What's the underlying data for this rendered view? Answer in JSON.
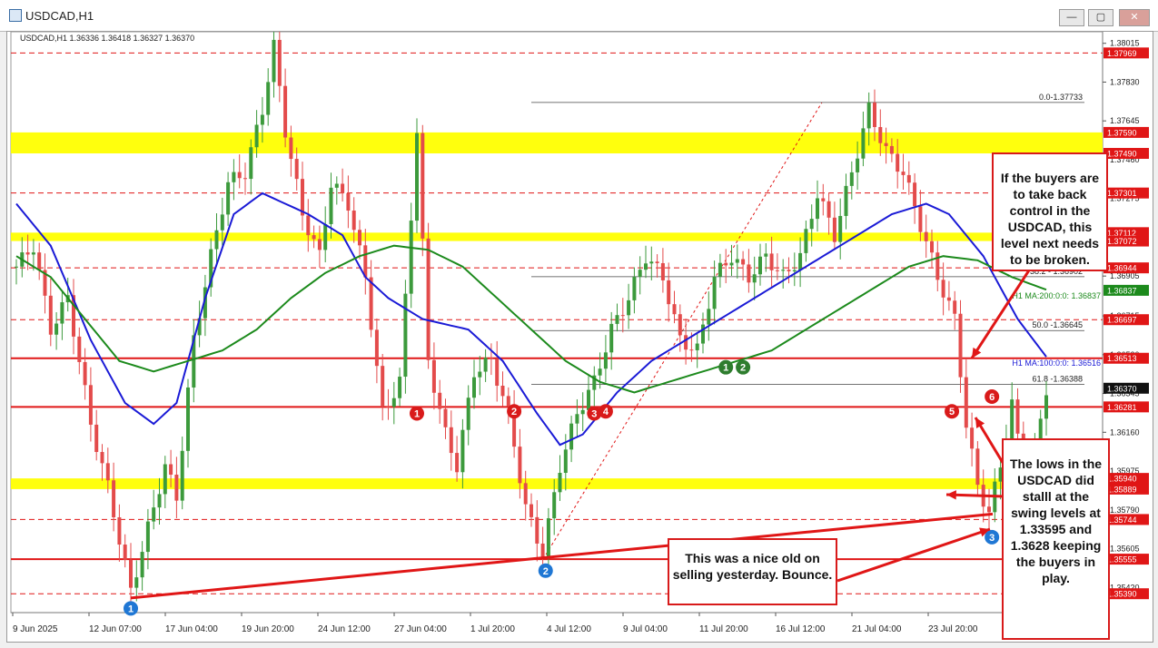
{
  "window": {
    "title": "USDCAD,H1",
    "min_label": "—",
    "max_label": "▢",
    "close_label": "✕"
  },
  "colors": {
    "blue": "#1a1ad6",
    "green": "#1c8a1c",
    "red": "#e01616",
    "yellow": "#ffff00",
    "bull": "#3c9a3c",
    "bear": "#e34b4b",
    "label_blue": "#1f77d4",
    "label_green": "#2e7d2e",
    "label_red": "#d91a1a"
  },
  "chart_data": {
    "type": "candlestick",
    "symbol": "USDCAD",
    "timeframe": "H1",
    "ohlc_header": "USDCAD,H1  1.36336 1.36418 1.36327 1.36370",
    "ylim": [
      1.353,
      1.3807
    ],
    "y_ticks": [
      "1.38015",
      "1.37830",
      "1.37645",
      "1.37460",
      "1.37275",
      "1.37090",
      "1.36905",
      "1.36715",
      "1.36530",
      "1.36345",
      "1.36160",
      "1.35975",
      "1.35790",
      "1.35605",
      "1.35420"
    ],
    "x_ticks": [
      "9 Jun 2025",
      "12 Jun 07:00",
      "17 Jun 04:00",
      "19 Jun 20:00",
      "24 Jun 12:00",
      "27 Jun 04:00",
      "1 Jul 20:00",
      "4 Jul 12:00",
      "9 Jul 04:00",
      "11 Jul 20:00",
      "16 Jul 12:00",
      "21 Jul 04:00",
      "23 Jul 20:00"
    ],
    "price_path": [
      [
        0,
        1.3695
      ],
      [
        3,
        1.3705
      ],
      [
        6,
        1.3665
      ],
      [
        9,
        1.368
      ],
      [
        13,
        1.362
      ],
      [
        16,
        1.359
      ],
      [
        20,
        1.354
      ],
      [
        23,
        1.357
      ],
      [
        26,
        1.36
      ],
      [
        28,
        1.3585
      ],
      [
        31,
        1.366
      ],
      [
        34,
        1.37
      ],
      [
        37,
        1.3735
      ],
      [
        40,
        1.374
      ],
      [
        43,
        1.377
      ],
      [
        45,
        1.38
      ],
      [
        47,
        1.376
      ],
      [
        50,
        1.372
      ],
      [
        53,
        1.37
      ],
      [
        55,
        1.3735
      ],
      [
        58,
        1.3725
      ],
      [
        61,
        1.369
      ],
      [
        64,
        1.3625
      ],
      [
        67,
        1.364
      ],
      [
        70,
        1.376
      ],
      [
        72,
        1.365
      ],
      [
        75,
        1.3615
      ],
      [
        77,
        1.36
      ],
      [
        80,
        1.3645
      ],
      [
        83,
        1.365
      ],
      [
        86,
        1.3625
      ],
      [
        89,
        1.358
      ],
      [
        92,
        1.3558
      ],
      [
        95,
        1.36
      ],
      [
        98,
        1.3625
      ],
      [
        101,
        1.364
      ],
      [
        104,
        1.3665
      ],
      [
        107,
        1.368
      ],
      [
        110,
        1.37
      ],
      [
        113,
        1.369
      ],
      [
        116,
        1.366
      ],
      [
        119,
        1.3655
      ],
      [
        122,
        1.369
      ],
      [
        125,
        1.37
      ],
      [
        128,
        1.369
      ],
      [
        131,
        1.37
      ],
      [
        134,
        1.369
      ],
      [
        137,
        1.37
      ],
      [
        140,
        1.373
      ],
      [
        143,
        1.371
      ],
      [
        146,
        1.374
      ],
      [
        149,
        1.377
      ],
      [
        152,
        1.375
      ],
      [
        155,
        1.374
      ],
      [
        158,
        1.3715
      ],
      [
        161,
        1.369
      ],
      [
        164,
        1.367
      ],
      [
        166,
        1.362
      ],
      [
        168,
        1.359
      ],
      [
        170,
        1.3578
      ],
      [
        172,
        1.36
      ],
      [
        174,
        1.363
      ],
      [
        176,
        1.3595
      ],
      [
        178,
        1.3605
      ],
      [
        180,
        1.3637
      ]
    ],
    "series": [
      {
        "name": "H1 MA:100:0:0: 1.36516",
        "values_path": [
          [
            0,
            1.3725
          ],
          [
            6,
            1.3705
          ],
          [
            13,
            1.366
          ],
          [
            19,
            1.363
          ],
          [
            24,
            1.362
          ],
          [
            28,
            1.363
          ],
          [
            33,
            1.368
          ],
          [
            38,
            1.372
          ],
          [
            43,
            1.373
          ],
          [
            51,
            1.372
          ],
          [
            57,
            1.371
          ],
          [
            61,
            1.369
          ],
          [
            65,
            1.368
          ],
          [
            71,
            1.367
          ],
          [
            79,
            1.3665
          ],
          [
            85,
            1.365
          ],
          [
            91,
            1.3625
          ],
          [
            95,
            1.361
          ],
          [
            99,
            1.3615
          ],
          [
            105,
            1.3635
          ],
          [
            111,
            1.365
          ],
          [
            117,
            1.366
          ],
          [
            123,
            1.367
          ],
          [
            129,
            1.368
          ],
          [
            135,
            1.369
          ],
          [
            141,
            1.37
          ],
          [
            147,
            1.371
          ],
          [
            153,
            1.372
          ],
          [
            159,
            1.3725
          ],
          [
            163,
            1.372
          ],
          [
            169,
            1.37
          ],
          [
            175,
            1.367
          ],
          [
            180,
            1.3652
          ]
        ]
      },
      {
        "name": "H1 MA:200:0:0: 1.36837",
        "values_path": [
          [
            0,
            1.37
          ],
          [
            6,
            1.369
          ],
          [
            12,
            1.367
          ],
          [
            18,
            1.365
          ],
          [
            24,
            1.3645
          ],
          [
            30,
            1.365
          ],
          [
            36,
            1.3655
          ],
          [
            42,
            1.3665
          ],
          [
            48,
            1.368
          ],
          [
            54,
            1.3692
          ],
          [
            60,
            1.37
          ],
          [
            66,
            1.3705
          ],
          [
            72,
            1.3703
          ],
          [
            78,
            1.3695
          ],
          [
            84,
            1.368
          ],
          [
            90,
            1.3665
          ],
          [
            96,
            1.365
          ],
          [
            102,
            1.364
          ],
          [
            108,
            1.3635
          ],
          [
            114,
            1.364
          ],
          [
            120,
            1.3645
          ],
          [
            126,
            1.365
          ],
          [
            132,
            1.3655
          ],
          [
            138,
            1.3665
          ],
          [
            144,
            1.3675
          ],
          [
            150,
            1.3685
          ],
          [
            156,
            1.3695
          ],
          [
            162,
            1.37
          ],
          [
            168,
            1.3698
          ],
          [
            174,
            1.369
          ],
          [
            180,
            1.3684
          ]
        ]
      }
    ],
    "fibonacci": {
      "high": 1.37733,
      "low": 1.35555,
      "levels": [
        {
          "label": "0.0-1.37733",
          "value": 1.37733
        },
        {
          "label": "38.2 - 1.36902",
          "value": 1.36902
        },
        {
          "label": "50.0 -1.36645",
          "value": 1.36645
        },
        {
          "label": "61.8 -1.36388",
          "value": 1.36388
        }
      ]
    },
    "yellow_zones": [
      [
        1.3749,
        1.3759
      ],
      [
        1.37072,
        1.37112
      ],
      [
        1.35889,
        1.3594
      ]
    ],
    "red_levels": [
      {
        "label": "1.37969",
        "value": 1.37969,
        "style": "dash"
      },
      {
        "label": "1.37301",
        "value": 1.37301,
        "style": "dash"
      },
      {
        "label": "1.36944",
        "value": 1.36944,
        "style": "dash"
      },
      {
        "label": "1.36697",
        "value": 1.36697,
        "style": "dash"
      },
      {
        "label": "1.36513",
        "value": 1.36513,
        "style": "solid"
      },
      {
        "label": "1.36281",
        "value": 1.36281,
        "style": "solid"
      },
      {
        "label": "1.35744",
        "value": 1.35744,
        "style": "dash"
      },
      {
        "label": "1.35555",
        "value": 1.35555,
        "style": "solid"
      },
      {
        "label": "1.35390",
        "value": 1.3539,
        "style": "dash"
      }
    ],
    "right_tags": [
      {
        "label": "1.37969",
        "color": "red"
      },
      {
        "label": "1.37590",
        "color": "red"
      },
      {
        "label": "1.37490",
        "color": "red"
      },
      {
        "label": "1.37301",
        "color": "red"
      },
      {
        "label": "1.37112",
        "color": "red"
      },
      {
        "label": "1.37072",
        "color": "red"
      },
      {
        "label": "1.36944",
        "color": "red"
      },
      {
        "label": "1.36837",
        "color": "green"
      },
      {
        "label": "1.36697",
        "color": "red"
      },
      {
        "label": "1.36513",
        "color": "red"
      },
      {
        "label": "1.36370",
        "color": "black"
      },
      {
        "label": "1.36281",
        "color": "red"
      },
      {
        "label": "1.35940",
        "color": "red"
      },
      {
        "label": "1.35889",
        "color": "red"
      },
      {
        "label": "1.35744",
        "color": "red"
      },
      {
        "label": "1.35555",
        "color": "red"
      },
      {
        "label": "1.35390",
        "color": "red"
      }
    ],
    "swing_labels": [
      {
        "text": "1",
        "color": "blue",
        "x": 20,
        "y": 1.3532
      },
      {
        "text": "2",
        "color": "blue",
        "x": 92.5,
        "y": 1.355
      },
      {
        "text": "3",
        "color": "blue",
        "x": 170.5,
        "y": 1.3566
      },
      {
        "text": "1",
        "color": "green",
        "x": 124,
        "y": 1.3647
      },
      {
        "text": "2",
        "color": "green",
        "x": 127,
        "y": 1.3647
      },
      {
        "text": "1",
        "color": "red",
        "x": 70,
        "y": 1.3625
      },
      {
        "text": "2",
        "color": "red",
        "x": 87,
        "y": 1.3626
      },
      {
        "text": "3",
        "color": "red",
        "x": 101,
        "y": 1.3625
      },
      {
        "text": "4",
        "color": "red",
        "x": 103,
        "y": 1.3626
      },
      {
        "text": "5",
        "color": "red",
        "x": 163.5,
        "y": 1.3626
      },
      {
        "text": "6",
        "color": "red",
        "x": 170.5,
        "y": 1.3633
      }
    ],
    "annotations": [
      "If the buyers are to take back control in the USDCAD, this level next needs to be broken.",
      "The lows in the USDCAD did stalll at the swing levels at 1.33595 and 1.3628 keeping the buyers in play.",
      "This was a nice old on selling yesterday. Bounce."
    ]
  }
}
